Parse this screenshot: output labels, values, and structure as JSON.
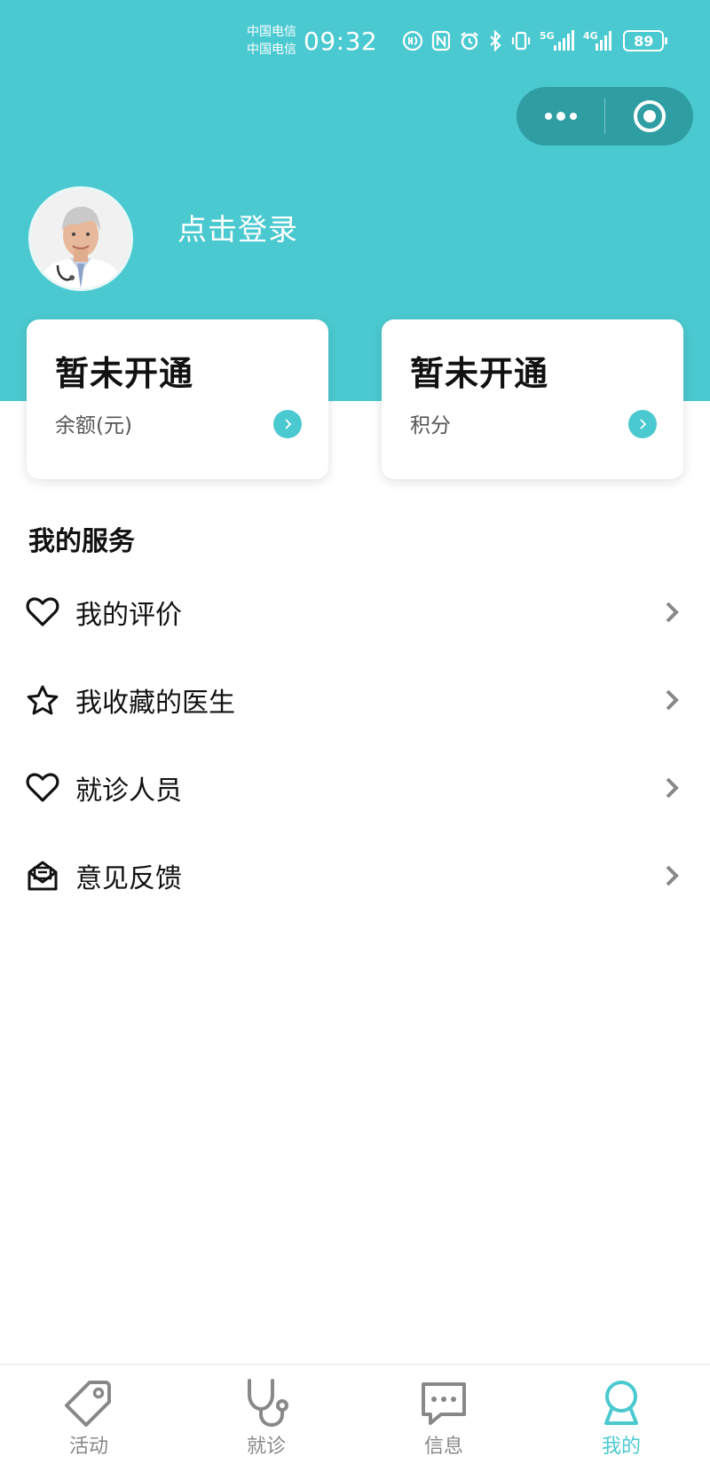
{
  "status_bar": {
    "carrier_1": "中国电信",
    "carrier_2": "中国电信",
    "time": "09:32",
    "network_5g": "5G",
    "network_4g": "4G",
    "battery": "89"
  },
  "profile": {
    "login_text": "点击登录"
  },
  "cards": [
    {
      "value": "暂未开通",
      "label": "余额(元)"
    },
    {
      "value": "暂未开通",
      "label": "积分"
    }
  ],
  "services": {
    "title": "我的服务",
    "items": [
      {
        "label": "我的评价",
        "icon": "heart-icon"
      },
      {
        "label": "我收藏的医生",
        "icon": "star-icon"
      },
      {
        "label": "就诊人员",
        "icon": "heart-icon"
      },
      {
        "label": "意见反馈",
        "icon": "mail-icon"
      }
    ]
  },
  "tabbar": {
    "items": [
      {
        "label": "活动",
        "icon": "tag-icon",
        "active": false
      },
      {
        "label": "就诊",
        "icon": "stethoscope-icon",
        "active": false
      },
      {
        "label": "信息",
        "icon": "message-icon",
        "active": false
      },
      {
        "label": "我的",
        "icon": "person-icon",
        "active": true
      }
    ]
  },
  "colors": {
    "brand": "#4BC9D0",
    "capsule": "#2E9EA3",
    "text_primary": "#111111",
    "text_secondary": "#555555",
    "tab_inactive": "#888888"
  }
}
